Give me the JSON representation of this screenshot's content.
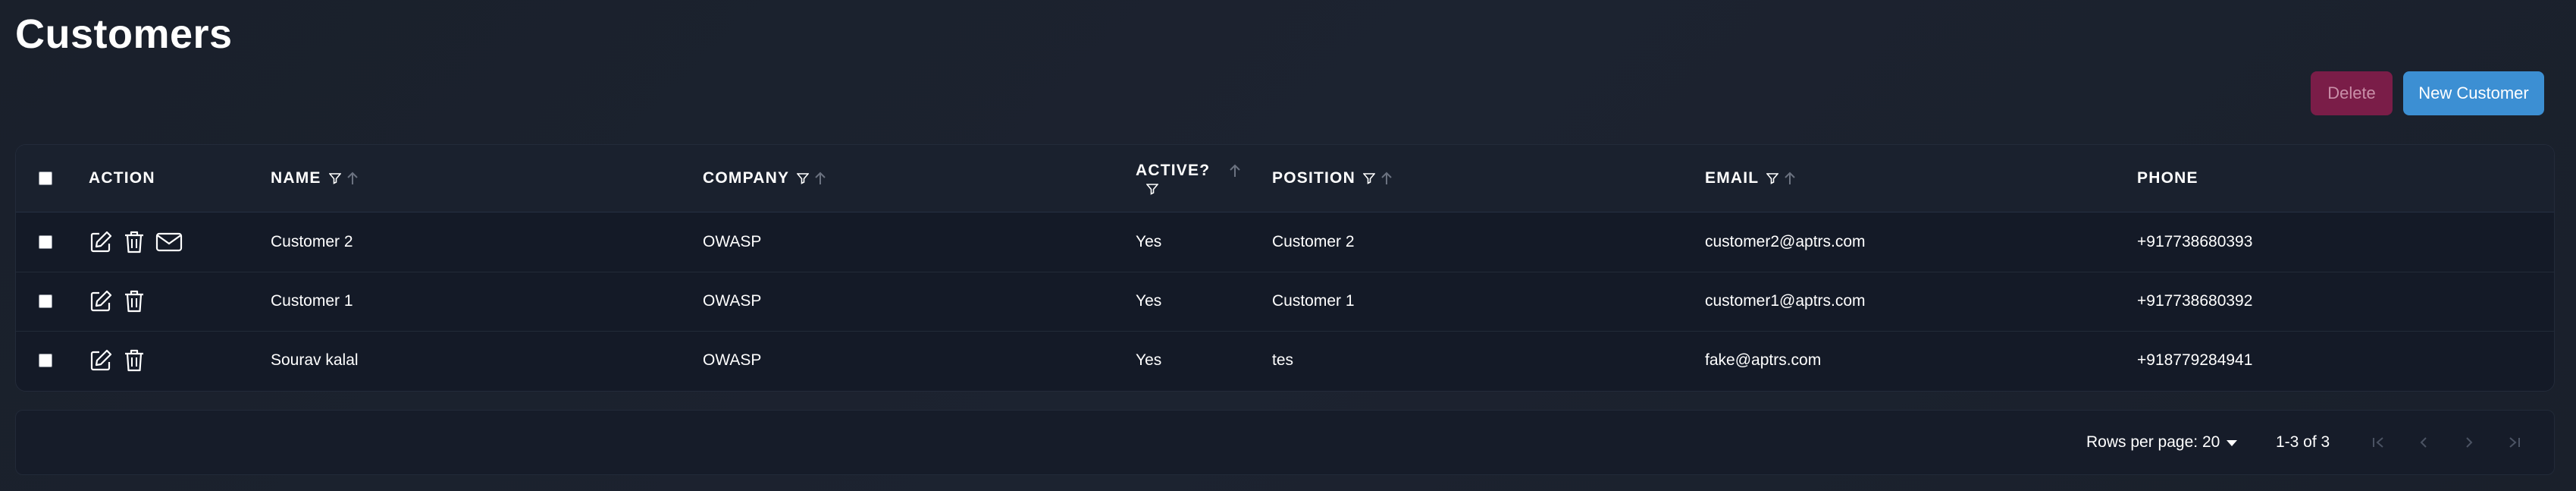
{
  "page": {
    "title": "Customers"
  },
  "toolbar": {
    "delete_label": "Delete",
    "new_label": "New Customer"
  },
  "table": {
    "columns": {
      "action": "ACTION",
      "name": "NAME",
      "company": "COMPANY",
      "active": "ACTIVE?",
      "position": "POSITION",
      "email": "EMAIL",
      "phone": "PHONE"
    },
    "rows": [
      {
        "name": "Customer 2",
        "company": "OWASP",
        "active": "Yes",
        "position": "Customer 2",
        "email": "customer2@aptrs.com",
        "phone": "+917738680393",
        "actions": [
          "edit-icon",
          "trash-icon",
          "mail-icon"
        ]
      },
      {
        "name": "Customer 1",
        "company": "OWASP",
        "active": "Yes",
        "position": "Customer 1",
        "email": "customer1@aptrs.com",
        "phone": "+917738680392",
        "actions": [
          "edit-icon",
          "trash-icon"
        ]
      },
      {
        "name": "Sourav kalal",
        "company": "OWASP",
        "active": "Yes",
        "position": "tes",
        "email": "fake@aptrs.com",
        "phone": "+918779284941",
        "actions": [
          "edit-icon",
          "trash-icon"
        ]
      }
    ]
  },
  "pagination": {
    "rows_per_page_label": "Rows per page:",
    "rows_per_page_value": "20",
    "range": "1-3 of 3",
    "nav_icons": [
      "first-page-icon",
      "prev-page-icon",
      "next-page-icon",
      "last-page-icon"
    ]
  },
  "colors": {
    "background": "#1b212c",
    "table_bg": "#141a27",
    "delete_button": "#7a1d48",
    "new_button": "#3c8fd3"
  }
}
